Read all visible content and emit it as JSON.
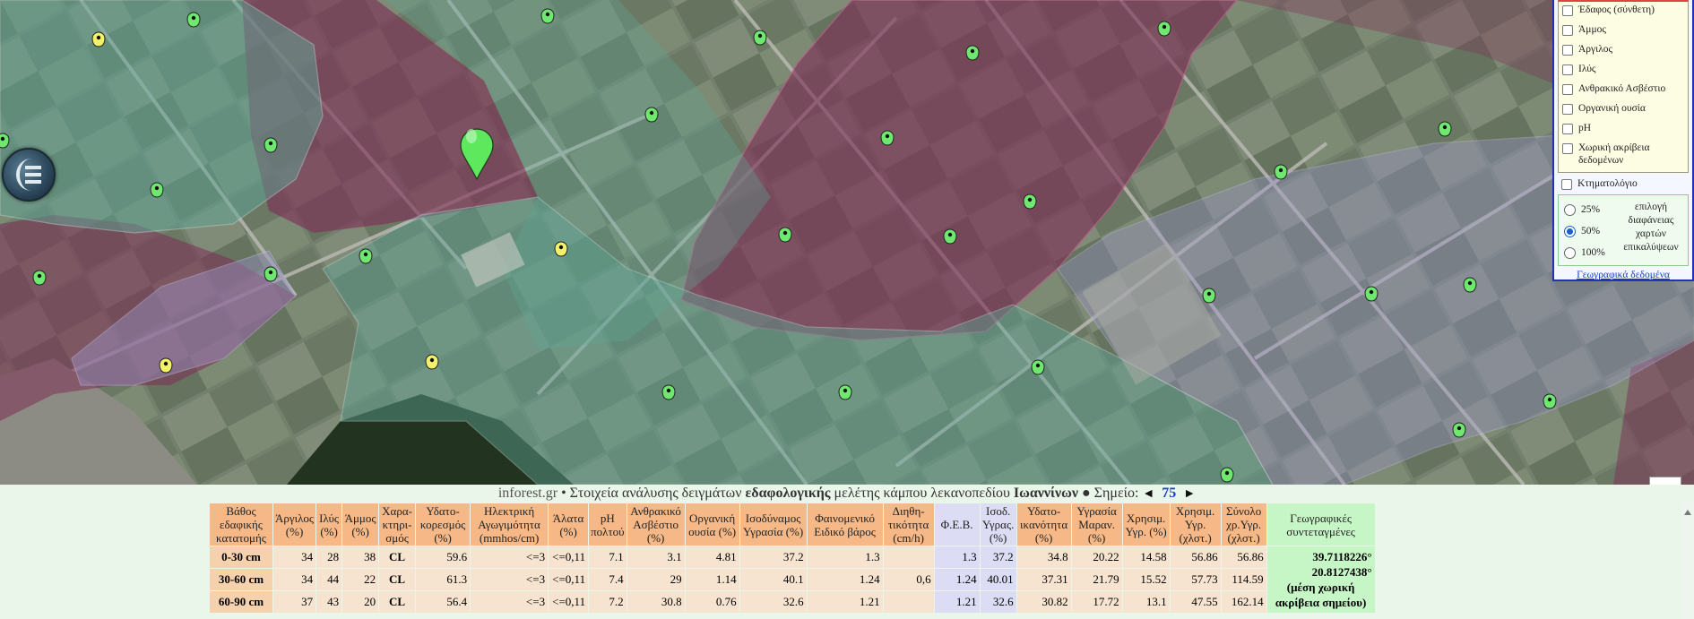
{
  "map": {
    "logo_icon": "inforest-logo-icon",
    "selected_marker": "selected-point-marker",
    "green_markers": [
      {
        "color": "#6ee86e"
      }
    ],
    "yellow_markers": [
      {
        "color": "#f3f06a"
      }
    ],
    "colors": {
      "soil_zone_purple": "#7e2f56",
      "soil_zone_teal": "#5fa596",
      "soil_zone_lilac": "#9a93c8",
      "imagery": "#6f7d6c"
    }
  },
  "layers": {
    "items": [
      {
        "label": "Έδαφος (σύνθετη)",
        "checked": false
      },
      {
        "label": "Άμμος",
        "checked": false
      },
      {
        "label": "Άργιλος",
        "checked": false
      },
      {
        "label": "Ιλύς",
        "checked": false
      },
      {
        "label": "Ανθρακικό Ασβέστιο",
        "checked": false
      },
      {
        "label": "Οργανική ουσία",
        "checked": false
      },
      {
        "label": "pH",
        "checked": false
      },
      {
        "label": "Χωρική ακρίβεια δεδομένων",
        "checked": false
      }
    ],
    "cadastre_label": "Κτηματολόγιο",
    "opacity_options": [
      "25%",
      "50%",
      "100%"
    ],
    "opacity_selected": "50%",
    "opacity_desc": "επιλογή διαφάνειας χαρτών επικαλύψεων",
    "geo_link": "Γεωγραφικά δεδομένα"
  },
  "info": {
    "site": "inforest.gr",
    "bullet": "•",
    "text1": "Στοιχεία ανάλυσης δειγμάτων",
    "bold1": "εδαφολογικής",
    "text2": "μελέτης κάμπου λεκανοπεδίου",
    "bold2": "Ιωαννίνων",
    "point_label": "● Σημείο:",
    "prev_arrow": "◄",
    "point_number": "75",
    "next_arrow": "►"
  },
  "table": {
    "headers": [
      "Βάθος εδαφικής κατατομής",
      "Άργιλος (%)",
      "Ιλύς (%)",
      "Άμμος (%)",
      "Χαρα-κτηρι-σμός",
      "Υδατο-κορεσμός (%)",
      "Ηλεκτρική Αγωγιμότητα (mmhos/cm)",
      "Άλατα (%)",
      "pH πολτού",
      "Ανθρακικό Ασβέστιο (%)",
      "Οργανική ουσία (%)",
      "Ισοδύναμος Υγρασία (%)",
      "Φαινομενικό Ειδικό βάρος",
      "Διηθη-τικότητα (cm/h)",
      "Φ.Ε.Β.",
      "Ισοδ. Υγρας. (%)",
      "Υδατο-ικανότητα (%)",
      "Υγρασία Μαραν. (%)",
      "Χρησιμ. Υγρ. (%)",
      "Χρησιμ. Υγρ. (χλστ.)",
      "Σύνολο χρ.Υγρ. (χλστ.)",
      "Γεωγραφικές συντεταγμένες"
    ],
    "rows": [
      [
        "0-30 cm",
        "34",
        "28",
        "38",
        "CL",
        "59.6",
        "<=3",
        "<=0,11",
        "7.1",
        "3.1",
        "4.81",
        "37.2",
        "1.3",
        "",
        "1.3",
        "37.2",
        "34.8",
        "20.22",
        "14.58",
        "56.86",
        "56.86"
      ],
      [
        "30-60 cm",
        "34",
        "44",
        "22",
        "CL",
        "61.3",
        "<=3",
        "<=0,11",
        "7.4",
        "29",
        "1.14",
        "40.1",
        "1.24",
        "0,6",
        "1.24",
        "40.01",
        "37.31",
        "21.79",
        "15.52",
        "57.73",
        "114.59"
      ],
      [
        "60-90 cm",
        "37",
        "43",
        "20",
        "CL",
        "56.4",
        "<=3",
        "<=0,11",
        "7.2",
        "30.8",
        "0.76",
        "32.6",
        "1.21",
        "",
        "1.21",
        "32.6",
        "30.82",
        "17.72",
        "13.1",
        "47.55",
        "162.14"
      ]
    ],
    "geo": {
      "lat": "39.7118226°",
      "lon": "20.8127438°",
      "note": "(μέση χωρική ακρίβεια σημείου)"
    }
  }
}
